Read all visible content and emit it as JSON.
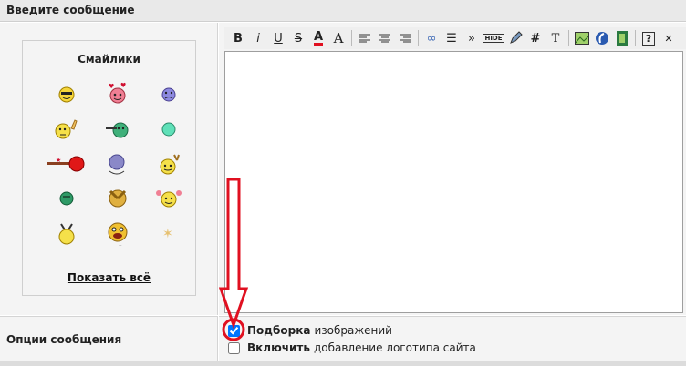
{
  "header": {
    "title": "Введите сообщение"
  },
  "smilies": {
    "title": "Смайлики",
    "show_all": "Показать всё",
    "items": [
      "cool-smiley-icon",
      "in-love-smiley-icon",
      "sad-smiley-icon",
      "pointing-smiley-icon",
      "shooting-smiley-icon",
      "mint-smiley-icon",
      "gun-smiley-icon",
      "bouncing-smiley-icon",
      "waving-smiley-icon",
      "green-smiley-icon",
      "clapping-smiley-icon",
      "pigtails-smiley-icon",
      "antenna-smiley-icon",
      "laughing-smiley-icon",
      "star-icon"
    ]
  },
  "toolbar": {
    "bold": "B",
    "italic": "i",
    "underline": "U",
    "strike": "S",
    "color": "A",
    "size": "A",
    "link": "∞",
    "list": "☰",
    "quote": "»",
    "hide": "HIDE",
    "hash": "#",
    "text": "T",
    "help": "?",
    "close": "✕"
  },
  "editor": {
    "value": ""
  },
  "options": {
    "label": "Опции сообщения",
    "opt1_bold": "Подборка",
    "opt1_text": "изображений",
    "opt1_checked": true,
    "opt2_bold": "Включить",
    "opt2_text": "добавление логотипа сайта",
    "opt2_checked": false
  },
  "colors": {
    "accent_red": "#e01020",
    "header_bg": "#e9e9e9",
    "panel_bg": "#f4f4f4"
  }
}
